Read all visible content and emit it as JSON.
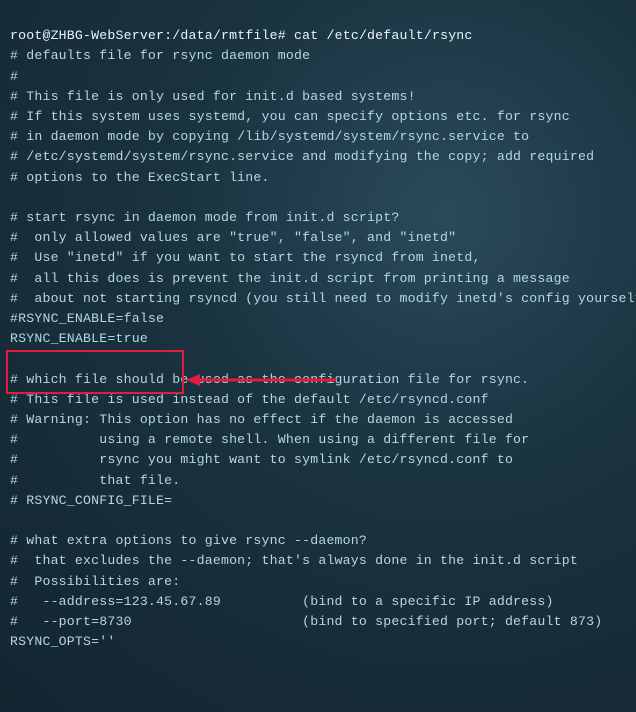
{
  "prompt": {
    "user_host": "root@ZHBG-WebServer",
    "path": "/data/rmtfile",
    "symbol": "#",
    "command": "cat /etc/default/rsync"
  },
  "lines": [
    "# defaults file for rsync daemon mode",
    "#",
    "# This file is only used for init.d based systems!",
    "# If this system uses systemd, you can specify options etc. for rsync",
    "# in daemon mode by copying /lib/systemd/system/rsync.service to",
    "# /etc/systemd/system/rsync.service and modifying the copy; add required",
    "# options to the ExecStart line.",
    "",
    "# start rsync in daemon mode from init.d script?",
    "#  only allowed values are \"true\", \"false\", and \"inetd\"",
    "#  Use \"inetd\" if you want to start the rsyncd from inetd,",
    "#  all this does is prevent the init.d script from printing a message",
    "#  about not starting rsyncd (you still need to modify inetd's config yourself).",
    "#RSYNC_ENABLE=false",
    "RSYNC_ENABLE=true",
    "",
    "# which file should be used as the configuration file for rsync.",
    "# This file is used instead of the default /etc/rsyncd.conf",
    "# Warning: This option has no effect if the daemon is accessed",
    "#          using a remote shell. When using a different file for",
    "#          rsync you might want to symlink /etc/rsyncd.conf to",
    "#          that file.",
    "# RSYNC_CONFIG_FILE=",
    "",
    "# what extra options to give rsync --daemon?",
    "#  that excludes the --daemon; that's always done in the init.d script",
    "#  Possibilities are:",
    "#   --address=123.45.67.89          (bind to a specific IP address)",
    "#   --port=8730                     (bind to specified port; default 873)",
    "RSYNC_OPTS=''"
  ],
  "annotation": {
    "highlight_label": "rsync-enable-highlight",
    "arrow_label": "arrow-to-highlight"
  }
}
